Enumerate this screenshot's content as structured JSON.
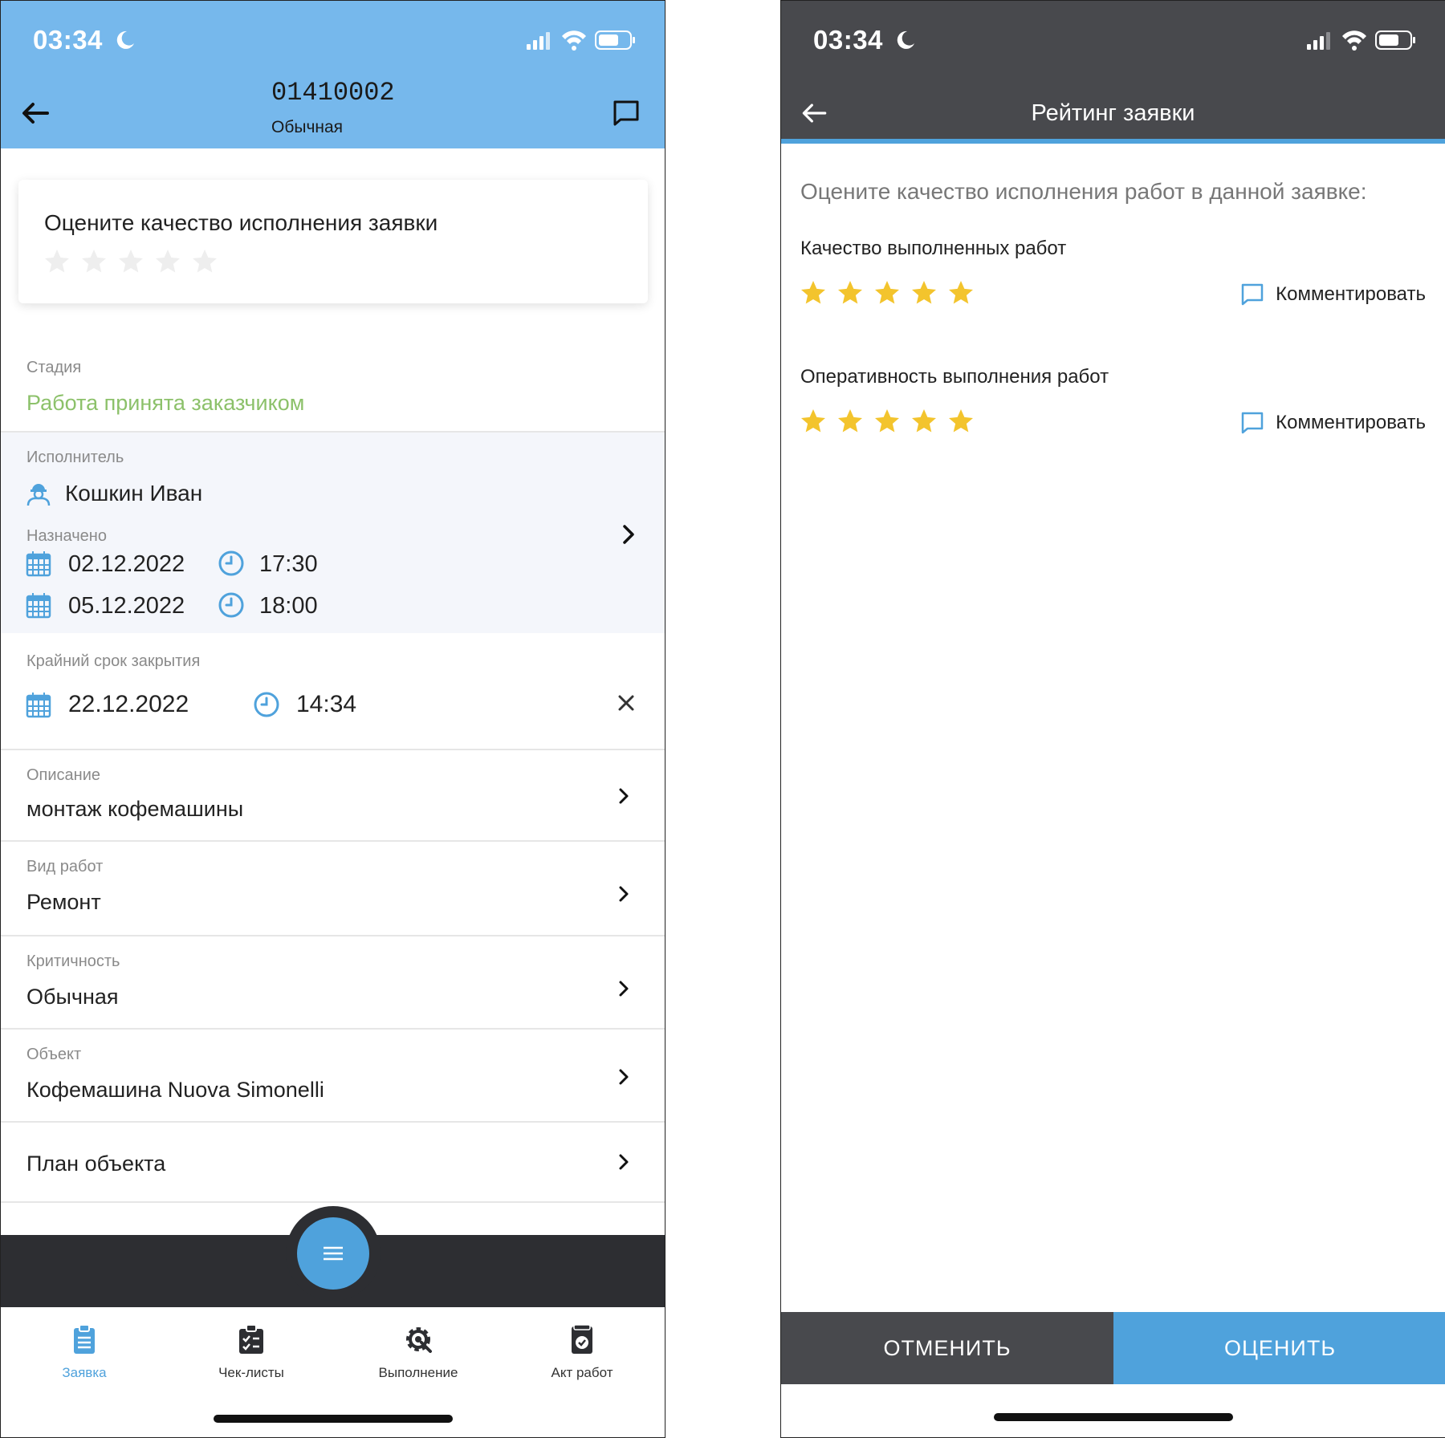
{
  "status_bar": {
    "time": "03:34"
  },
  "colors": {
    "header_blue": "#76b8ec",
    "accent": "#4fa2dc",
    "stage_green": "#8cc16a",
    "dark_bar": "#2d2e32",
    "star_gold": "#f3c42d",
    "star_empty": "#eeeeee",
    "right_header": "#48494d"
  },
  "left": {
    "header": {
      "title": "01410002",
      "subtitle": "Обычная",
      "back_icon": "arrow-left-icon",
      "chat_icon": "chat-bubble-icon"
    },
    "rating_card": {
      "title": "Оцените качество исполнения заявки",
      "stars_filled": 0,
      "stars_total": 5
    },
    "stage": {
      "label": "Стадия",
      "value": "Работа принята заказчиком"
    },
    "executor": {
      "label": "Исполнитель",
      "name": "Кошкин Иван"
    },
    "assigned": {
      "label": "Назначено",
      "rows": [
        {
          "date": "02.12.2022",
          "time": "17:30"
        },
        {
          "date": "05.12.2022",
          "time": "18:00"
        }
      ]
    },
    "deadline": {
      "label": "Крайний срок закрытия",
      "date": "22.12.2022",
      "time": "14:34"
    },
    "description": {
      "label": "Описание",
      "value": "монтаж кофемашины"
    },
    "work_type": {
      "label": "Вид работ",
      "value": "Ремонт"
    },
    "criticality": {
      "label": "Критичность",
      "value": "Обычная"
    },
    "object": {
      "label": "Объект",
      "value": "Кофемашина Nuova Simonelli"
    },
    "plan": {
      "value": "План объекта"
    },
    "tabs": [
      {
        "label": "Заявка",
        "icon": "clipboard-icon",
        "active": true
      },
      {
        "label": "Чек-листы",
        "icon": "checklist-icon",
        "active": false
      },
      {
        "label": "Выполнение",
        "icon": "gear-icon",
        "active": false
      },
      {
        "label": "Акт работ",
        "icon": "act-document-icon",
        "active": false
      }
    ]
  },
  "right": {
    "header": {
      "title": "Рейтинг заявки"
    },
    "intro": "Оцените качество исполнения работ в данной заявке:",
    "criteria": [
      {
        "label": "Качество выполненных работ",
        "stars_filled": 5,
        "stars_total": 5,
        "comment_label": "Комментировать"
      },
      {
        "label": "Оперативность выполнения работ",
        "stars_filled": 5,
        "stars_total": 5,
        "comment_label": "Комментировать"
      }
    ],
    "buttons": {
      "cancel": "ОТМЕНИТЬ",
      "submit": "ОЦЕНИТЬ"
    }
  }
}
